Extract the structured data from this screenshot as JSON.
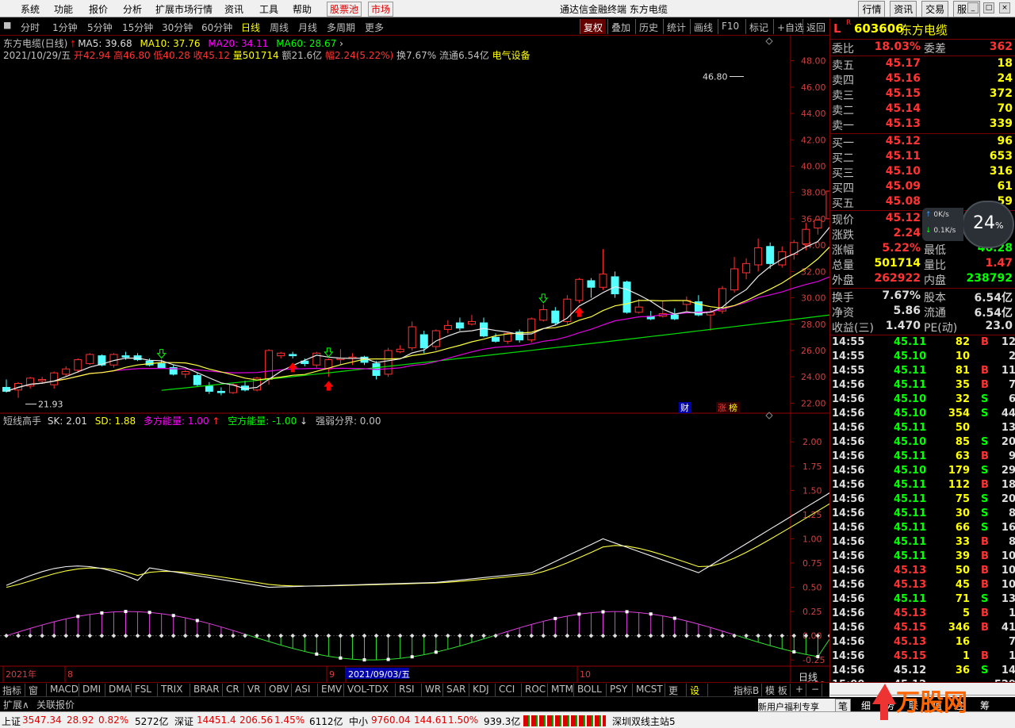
{
  "menu": {
    "items": [
      "系统",
      "功能",
      "报价",
      "分析",
      "扩展市场行情",
      "资讯",
      "工具",
      "帮助"
    ],
    "gupiao": "股票池",
    "shichang": "市场",
    "title": "通达信金融终端 东方电缆",
    "right": [
      "行情",
      "资讯",
      "交易",
      "服务"
    ]
  },
  "periods": {
    "items": [
      "分时",
      "1分钟",
      "5分钟",
      "15分钟",
      "30分钟",
      "60分钟",
      "日线",
      "周线",
      "月线",
      "多周期",
      "更多"
    ],
    "active": 6,
    "tools": [
      "复权",
      "叠加",
      "历史",
      "统计",
      "画线",
      "F10",
      "标记",
      "+自选",
      "返回"
    ]
  },
  "ma": {
    "name": "东方电缆(日线)",
    "ma5": "MA5: 39.68",
    "ma10": "MA10: 37.76",
    "ma20": "MA20: 34.11",
    "ma60": "MA60: 28.67"
  },
  "info": {
    "date": "2021/10/29/五",
    "open": "开42.94",
    "high": "高46.80",
    "low": "低40.28",
    "close": "收45.12",
    "vol": "量501714",
    "amt": "额21.6亿",
    "fu": "幅2.24(5.22%)",
    "huan": "换7.67%",
    "liutong": "流通6.54亿",
    "sector": "电气设备"
  },
  "axis": {
    "y_main": [
      "48.00",
      "46.00",
      "44.00",
      "42.00",
      "40.00",
      "38.00",
      "36.00",
      "34.00",
      "32.00",
      "30.00",
      "28.00",
      "26.00",
      "24.00",
      "22.00"
    ],
    "y_ind": [
      "2.00",
      "1.75",
      "1.50",
      "1.25",
      "1.00",
      "0.75",
      "0.50",
      "0.25",
      "0.00",
      "-0.25",
      "-0.50"
    ],
    "x": [
      "2021年",
      "8",
      "9",
      "2021/09/03/五",
      "10"
    ],
    "hi_label": "46.80",
    "lo_label": "21.93",
    "cai": "财",
    "zhang": "涨",
    "tong": "榜"
  },
  "indicator": {
    "name": "短线高手",
    "sk": "SK: 2.01",
    "sd": "SD: 1.88",
    "duo": "多方能量: 1.00",
    "kong": "空方能量: -1.00",
    "qiang": "强弱分界: 0.00"
  },
  "tabs": [
    "指标A",
    "窗口",
    "MACD",
    "DMI",
    "DMA",
    "FSL",
    "TRIX",
    "BRAR",
    "CR",
    "VR",
    "OBV",
    "ASI",
    "EMV",
    "VOL-TDX",
    "RSI",
    "WR",
    "SAR",
    "KDJ",
    "CCI",
    "ROC",
    "MTM",
    "BOLL",
    "PSY",
    "MCST",
    "更多",
    "设置"
  ],
  "tabs_right": [
    "指标B",
    "模 板",
    "+",
    "−",
    "日线"
  ],
  "bot2": [
    "扩展∧",
    "关联报价"
  ],
  "stock": {
    "code": "603606",
    "name": "东方电缆",
    "wb_label": "委比",
    "wb": "18.03%",
    "wc_label": "委差",
    "wc": "362"
  },
  "sell": [
    {
      "l": "卖五",
      "p": "45.17",
      "v": "18"
    },
    {
      "l": "卖四",
      "p": "45.16",
      "v": "24"
    },
    {
      "l": "卖三",
      "p": "45.15",
      "v": "372"
    },
    {
      "l": "卖二",
      "p": "45.14",
      "v": "70"
    },
    {
      "l": "卖一",
      "p": "45.13",
      "v": "339"
    }
  ],
  "buy": [
    {
      "l": "买一",
      "p": "45.12",
      "v": "96"
    },
    {
      "l": "买二",
      "p": "45.11",
      "v": "653"
    },
    {
      "l": "买三",
      "p": "45.10",
      "v": "316"
    },
    {
      "l": "买四",
      "p": "45.09",
      "v": "61"
    },
    {
      "l": "买五",
      "p": "45.08",
      "v": "59"
    }
  ],
  "quote": [
    {
      "l1": "现价",
      "v1": "45.12",
      "l2": "今开",
      "v2": "42.94"
    },
    {
      "l1": "涨跌",
      "v1": "2.24",
      "l2": "最高",
      "v2": "46.80"
    },
    {
      "l1": "涨幅",
      "v1": "5.22%",
      "l2": "最低",
      "v2": "40.28"
    },
    {
      "l1": "总量",
      "v1": "501714",
      "l2": "量比",
      "v2": "1.47"
    },
    {
      "l1": "外盘",
      "v1": "262922",
      "l2": "内盘",
      "v2": "238792"
    }
  ],
  "fin": [
    {
      "l1": "换手",
      "v1": "7.67%",
      "l2": "股本",
      "v2": "6.54亿"
    },
    {
      "l1": "净资",
      "v1": "5.86",
      "l2": "流通",
      "v2": "6.54亿"
    },
    {
      "l1": "收益(三)",
      "v1": "1.470",
      "l2": "PE(动)",
      "v2": "23.0"
    }
  ],
  "speed": {
    "val": "24",
    "pct": "%",
    "up": "0K/s",
    "down": "0.1K/s"
  },
  "ticks": [
    [
      "14:55",
      "45.11",
      "82",
      "B",
      "12"
    ],
    [
      "14:55",
      "45.10",
      "10",
      "",
      "2"
    ],
    [
      "14:55",
      "45.11",
      "81",
      "B",
      "11"
    ],
    [
      "14:56",
      "45.11",
      "35",
      "B",
      "7"
    ],
    [
      "14:56",
      "45.10",
      "32",
      "S",
      "6"
    ],
    [
      "14:56",
      "45.10",
      "354",
      "S",
      "44"
    ],
    [
      "14:56",
      "45.11",
      "50",
      "",
      "13"
    ],
    [
      "14:56",
      "45.10",
      "85",
      "S",
      "20"
    ],
    [
      "14:56",
      "45.11",
      "63",
      "B",
      "9"
    ],
    [
      "14:56",
      "45.10",
      "179",
      "S",
      "29"
    ],
    [
      "14:56",
      "45.11",
      "112",
      "B",
      "18"
    ],
    [
      "14:56",
      "45.11",
      "75",
      "S",
      "20"
    ],
    [
      "14:56",
      "45.11",
      "30",
      "S",
      "8"
    ],
    [
      "14:56",
      "45.11",
      "66",
      "S",
      "16"
    ],
    [
      "14:56",
      "45.11",
      "33",
      "B",
      "8"
    ],
    [
      "14:56",
      "45.11",
      "39",
      "B",
      "10"
    ],
    [
      "14:56",
      "45.13",
      "50",
      "B",
      "10"
    ],
    [
      "14:56",
      "45.13",
      "45",
      "B",
      "10"
    ],
    [
      "14:56",
      "45.11",
      "71",
      "S",
      "13"
    ],
    [
      "14:56",
      "45.13",
      "5",
      "B",
      "1"
    ],
    [
      "14:56",
      "45.15",
      "346",
      "B",
      "41"
    ],
    [
      "14:56",
      "45.13",
      "16",
      "",
      "7"
    ],
    [
      "14:56",
      "45.15",
      "1",
      "B",
      "1"
    ],
    [
      "14:56",
      "45.12",
      "36",
      "S",
      "14"
    ],
    [
      "15:00",
      "45.12",
      "",
      "",
      "529"
    ]
  ],
  "rbot": [
    "新用户福利专享",
    "笔",
    "细",
    "势",
    "联",
    "值",
    "主",
    "筹"
  ],
  "status": {
    "sh_name": "上证",
    "sh": "3547.34",
    "sh_chg": "28.92",
    "sh_pct": "0.82%",
    "sh_amt": "5272亿",
    "sz_name": "深证",
    "sz": "14451.4",
    "sz_chg": "206.56",
    "sz_pct": "1.45%",
    "sz_amt": "6112亿",
    "zx_name": "中小",
    "zx": "9760.04",
    "zx_chg": "144.61",
    "zx_pct": "1.50%",
    "zx_amt": "939.3亿",
    "server": "深圳双线主站5"
  },
  "chart_data": {
    "type": "candlestick",
    "ylim": [
      21,
      49
    ],
    "hi": "46.80",
    "lo": "21.93",
    "candles": [
      [
        23.2,
        23.8,
        22.8,
        22.9
      ],
      [
        23.0,
        23.6,
        22.4,
        23.5
      ],
      [
        23.3,
        24.0,
        23.1,
        23.9
      ],
      [
        23.7,
        24.0,
        23.5,
        23.8
      ],
      [
        23.4,
        24.4,
        23.1,
        24.3
      ],
      [
        24.2,
        24.8,
        24.0,
        24.6
      ],
      [
        24.5,
        25.4,
        24.3,
        25.3
      ],
      [
        25.0,
        25.8,
        24.9,
        25.7
      ],
      [
        25.6,
        25.7,
        24.8,
        24.9
      ],
      [
        24.9,
        25.8,
        24.7,
        25.7
      ],
      [
        25.6,
        25.9,
        25.3,
        25.5
      ],
      [
        25.6,
        25.8,
        25.2,
        25.3
      ],
      [
        25.2,
        25.4,
        24.8,
        24.9
      ],
      [
        25.0,
        25.3,
        24.6,
        24.7
      ],
      [
        24.7,
        24.9,
        24.1,
        24.2
      ],
      [
        24.2,
        24.5,
        23.9,
        24.4
      ],
      [
        24.1,
        24.3,
        23.3,
        23.4
      ],
      [
        23.3,
        23.6,
        22.7,
        22.9
      ],
      [
        22.9,
        23.2,
        22.6,
        22.8
      ],
      [
        22.8,
        23.5,
        22.7,
        23.4
      ],
      [
        23.3,
        23.7,
        22.9,
        23.0
      ],
      [
        23.0,
        24.0,
        22.9,
        23.9
      ],
      [
        23.8,
        26.1,
        23.4,
        26.0
      ],
      [
        25.6,
        25.9,
        25.4,
        25.8
      ],
      [
        25.7,
        25.9,
        25.4,
        25.6
      ],
      [
        25.2,
        25.4,
        24.8,
        25.0
      ],
      [
        24.9,
        25.9,
        24.7,
        25.8
      ],
      [
        24.6,
        25.4,
        24.0,
        25.3
      ],
      [
        25.3,
        26.1,
        24.9,
        25.4
      ],
      [
        25.4,
        25.8,
        24.9,
        25.5
      ],
      [
        25.5,
        25.6,
        24.9,
        25.1
      ],
      [
        25.0,
        25.2,
        23.8,
        24.1
      ],
      [
        24.2,
        26.2,
        24.0,
        26.0
      ],
      [
        25.9,
        26.4,
        25.8,
        26.1
      ],
      [
        26.2,
        28.2,
        26.0,
        27.8
      ],
      [
        27.2,
        27.5,
        25.8,
        26.2
      ],
      [
        26.3,
        27.6,
        26.0,
        27.5
      ],
      [
        27.6,
        28.3,
        27.3,
        27.9
      ],
      [
        28.1,
        28.5,
        27.5,
        27.7
      ],
      [
        28.0,
        28.7,
        27.9,
        28.2
      ],
      [
        28.1,
        28.5,
        27.0,
        27.1
      ],
      [
        27.0,
        27.3,
        26.6,
        26.7
      ],
      [
        26.7,
        27.4,
        26.5,
        27.3
      ],
      [
        27.4,
        27.6,
        26.6,
        26.8
      ],
      [
        26.8,
        28.5,
        26.6,
        28.4
      ],
      [
        28.3,
        29.5,
        28.2,
        29.1
      ],
      [
        29.0,
        29.3,
        27.9,
        28.1
      ],
      [
        28.2,
        30.2,
        28.0,
        29.9
      ],
      [
        29.8,
        31.5,
        29.6,
        31.4
      ],
      [
        31.3,
        31.5,
        30.0,
        30.8
      ],
      [
        30.8,
        33.7,
        30.6,
        31.8
      ],
      [
        31.6,
        32.0,
        30.0,
        30.3
      ],
      [
        31.2,
        31.3,
        28.8,
        28.9
      ],
      [
        28.9,
        29.9,
        28.8,
        29.3
      ],
      [
        28.6,
        29.0,
        28.3,
        28.4
      ],
      [
        28.6,
        29.8,
        28.5,
        28.8
      ],
      [
        28.7,
        29.2,
        28.3,
        28.4
      ],
      [
        29.5,
        30.1,
        29.0,
        29.8
      ],
      [
        29.7,
        30.2,
        28.6,
        28.7
      ],
      [
        28.7,
        29.2,
        27.5,
        28.9
      ],
      [
        29.0,
        30.9,
        28.8,
        30.7
      ],
      [
        30.6,
        33.1,
        30.4,
        32.2
      ],
      [
        31.9,
        33.0,
        31.4,
        32.6
      ],
      [
        32.5,
        34.5,
        32.0,
        33.8
      ],
      [
        33.9,
        34.2,
        32.2,
        32.6
      ],
      [
        32.5,
        33.9,
        32.3,
        33.5
      ],
      [
        33.3,
        34.4,
        32.9,
        34.2
      ],
      [
        34.1,
        35.7,
        33.6,
        35.2
      ],
      [
        35.3,
        36.0,
        34.8,
        35.9
      ],
      [
        36.0,
        38.4,
        35.8,
        38.1
      ],
      [
        38.5,
        38.6,
        36.5,
        36.6
      ],
      [
        35.7,
        36.4,
        34.2,
        35.0
      ],
      [
        34.5,
        35.6,
        33.9,
        35.5
      ],
      [
        35.4,
        36.0,
        34.8,
        35.9
      ],
      [
        35.7,
        36.2,
        35.1,
        35.4
      ],
      [
        35.1,
        39.5,
        35.0,
        39.4
      ],
      [
        40.0,
        43.3,
        39.5,
        43.0
      ],
      [
        42.94,
        46.8,
        40.28,
        45.12
      ]
    ],
    "series": {
      "ma5": [],
      "ma10": [],
      "ma20": [],
      "ma60": []
    },
    "indicator_ylim": [
      -0.6,
      2.1
    ]
  }
}
